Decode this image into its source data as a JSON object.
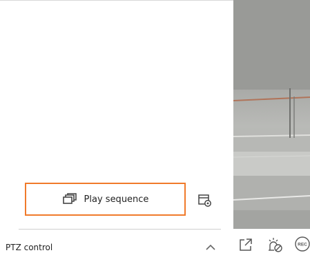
{
  "sequence": {
    "play_label": "Play sequence",
    "play_icon": "sequence-windows-icon",
    "settings_icon": "sequence-settings-icon"
  },
  "ptz": {
    "label": "PTZ control",
    "toggle_icon": "chevron-up-icon"
  },
  "video": {
    "toolbar": [
      {
        "icon": "popout-icon"
      },
      {
        "icon": "alarm-off-icon"
      },
      {
        "icon": "record-icon",
        "text": "REC"
      }
    ]
  },
  "colors": {
    "accent_border": "#f07a2a",
    "icon_color": "#555555"
  }
}
